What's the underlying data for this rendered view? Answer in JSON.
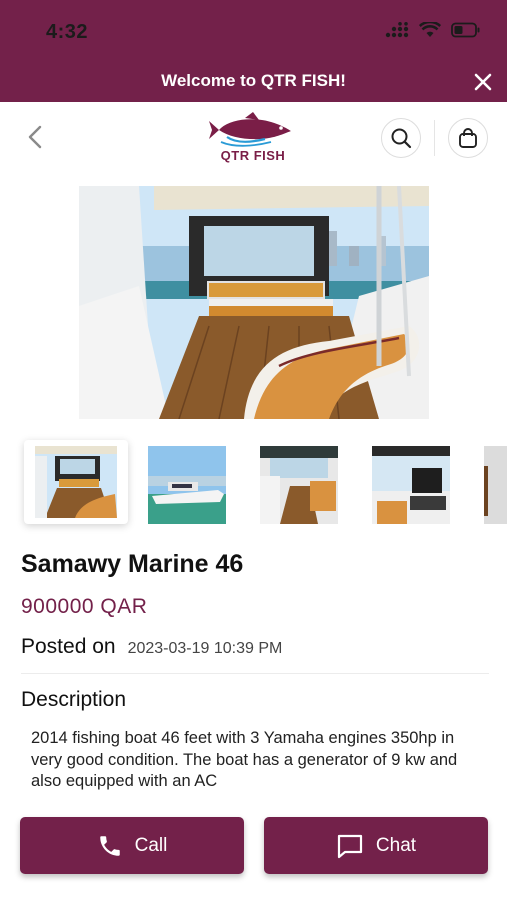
{
  "status_bar": {
    "time": "4:32"
  },
  "banner": {
    "text": "Welcome to QTR FISH!"
  },
  "header": {
    "logo_text": "QTR FISH"
  },
  "listing": {
    "title": "Samawy Marine 46",
    "price": "900000 QAR",
    "posted_label": "Posted on",
    "posted_date": "2023-03-19 10:39 PM",
    "description_heading": "Description",
    "description": "2014 fishing boat 46 feet with 3 Yamaha engines 350hp in very good condition. The boat has a generator of 9 kw and also equipped with an AC"
  },
  "actions": {
    "call_label": "Call",
    "chat_label": "Chat"
  },
  "colors": {
    "brand": "#73214a",
    "background": "#ffffff"
  },
  "icons": [
    "back-icon",
    "search-icon",
    "bag-icon",
    "close-icon",
    "phone-icon",
    "chat-icon"
  ]
}
